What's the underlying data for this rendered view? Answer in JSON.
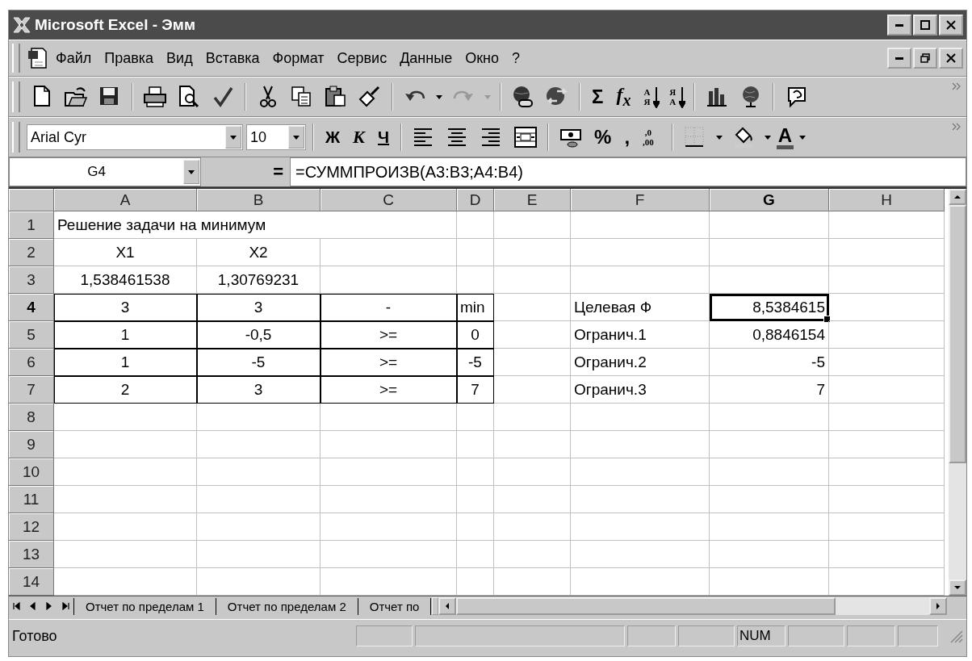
{
  "window": {
    "title": "Microsoft Excel - Эмм"
  },
  "menu": [
    {
      "label": "Файл"
    },
    {
      "label": "Правка"
    },
    {
      "label": "Вид"
    },
    {
      "label": "Вставка"
    },
    {
      "label": "Формат"
    },
    {
      "label": "Сервис"
    },
    {
      "label": "Данные"
    },
    {
      "label": "Окно"
    },
    {
      "label": "?"
    }
  ],
  "standard_toolbar": [
    {
      "kind": "new"
    },
    {
      "kind": "open"
    },
    {
      "kind": "save"
    },
    {
      "kind": "sep"
    },
    {
      "kind": "print"
    },
    {
      "kind": "preview"
    },
    {
      "kind": "spell"
    },
    {
      "kind": "sep"
    },
    {
      "kind": "cut"
    },
    {
      "kind": "copy"
    },
    {
      "kind": "paste"
    },
    {
      "kind": "brush"
    },
    {
      "kind": "sep"
    },
    {
      "kind": "undo"
    },
    {
      "kind": "drop"
    },
    {
      "kind": "redo"
    },
    {
      "kind": "drop_gray"
    },
    {
      "kind": "sep"
    },
    {
      "kind": "link"
    },
    {
      "kind": "web"
    },
    {
      "kind": "sep"
    },
    {
      "kind": "text",
      "label": "Σ"
    },
    {
      "kind": "fx",
      "label": "f$_{x}$"
    },
    {
      "kind": "sort",
      "top": "А",
      "bottom": "Я"
    },
    {
      "kind": "sort",
      "top": "Я",
      "bottom": "А"
    },
    {
      "kind": "sep"
    },
    {
      "kind": "chart"
    },
    {
      "kind": "map"
    },
    {
      "kind": "sep"
    },
    {
      "kind": "help"
    }
  ],
  "formatting_toolbar": {
    "font": "Arial Cyr",
    "size": "10",
    "items": [
      {
        "kind": "sep"
      },
      {
        "kind": "bold",
        "label": "Ж"
      },
      {
        "kind": "italic",
        "label": "К"
      },
      {
        "kind": "underline",
        "label": "Ч"
      },
      {
        "kind": "sep"
      },
      {
        "kind": "align_left"
      },
      {
        "kind": "align_center"
      },
      {
        "kind": "align_right"
      },
      {
        "kind": "merge"
      },
      {
        "kind": "sep"
      },
      {
        "kind": "currency"
      },
      {
        "kind": "text",
        "label": "%"
      },
      {
        "kind": "text",
        "label": ","
      },
      {
        "kind": "decimal",
        "top": ",0",
        "bottom": ",00"
      },
      {
        "kind": "sep"
      },
      {
        "kind": "borders"
      },
      {
        "kind": "drop"
      },
      {
        "kind": "fill"
      },
      {
        "kind": "drop"
      },
      {
        "kind": "fontcolor",
        "label": "A"
      },
      {
        "kind": "drop"
      }
    ]
  },
  "formula_bar": {
    "name_box": "G4",
    "equals": "=",
    "formula": "=СУММПРОИЗВ(A3:B3;A4:B4)"
  },
  "table": {
    "columns": [
      {
        "label": "A",
        "selected": false
      },
      {
        "label": "B",
        "selected": false
      },
      {
        "label": "C",
        "selected": false
      },
      {
        "label": "D",
        "selected": false
      },
      {
        "label": "E",
        "selected": false
      },
      {
        "label": "F",
        "selected": false
      },
      {
        "label": "G",
        "selected": true
      },
      {
        "label": "H",
        "selected": false
      }
    ],
    "rows": [
      {
        "header": "1",
        "selected": false,
        "cells": [
          "Решение задачи на минимум",
          null,
          null,
          null,
          null,
          null,
          null,
          null
        ]
      },
      {
        "header": "2",
        "selected": false,
        "cells": [
          "X1",
          "X2",
          null,
          null,
          null,
          null,
          null,
          null
        ]
      },
      {
        "header": "3",
        "selected": false,
        "cells": [
          "1,538461538",
          "1,30769231",
          null,
          null,
          null,
          null,
          null,
          null
        ]
      },
      {
        "header": "4",
        "selected": true,
        "cells": [
          "3",
          "3",
          "-",
          "min",
          null,
          "Целевая Ф",
          "8,5384615",
          null
        ]
      },
      {
        "header": "5",
        "selected": false,
        "cells": [
          "1",
          "-0,5",
          ">=",
          "0",
          null,
          "Огранич.1",
          "0,8846154",
          null
        ]
      },
      {
        "header": "6",
        "selected": false,
        "cells": [
          "1",
          "-5",
          ">=",
          "-5",
          null,
          "Огранич.2",
          "-5",
          null
        ]
      },
      {
        "header": "7",
        "selected": false,
        "cells": [
          "2",
          "3",
          ">=",
          "7",
          null,
          "Огранич.3",
          "7",
          null
        ]
      },
      {
        "header": "8",
        "selected": false,
        "cells": [
          null,
          null,
          null,
          null,
          null,
          null,
          null,
          null
        ]
      },
      {
        "header": "9",
        "selected": false,
        "cells": [
          null,
          null,
          null,
          null,
          null,
          null,
          null,
          null
        ]
      },
      {
        "header": "10",
        "selected": false,
        "cells": [
          null,
          null,
          null,
          null,
          null,
          null,
          null,
          null
        ]
      },
      {
        "header": "11",
        "selected": false,
        "cells": [
          null,
          null,
          null,
          null,
          null,
          null,
          null,
          null
        ]
      },
      {
        "header": "12",
        "selected": false,
        "cells": [
          null,
          null,
          null,
          null,
          null,
          null,
          null,
          null
        ]
      },
      {
        "header": "13",
        "selected": false,
        "cells": [
          null,
          null,
          null,
          null,
          null,
          null,
          null,
          null
        ]
      },
      {
        "header": "14",
        "selected": false,
        "cells": [
          null,
          null,
          null,
          null,
          null,
          null,
          null,
          null
        ]
      }
    ]
  },
  "sheet_tabs": [
    {
      "label": "Отчет по пределам 1",
      "selected": false
    },
    {
      "label": "Отчет по пределам 2",
      "selected": false
    },
    {
      "label": "Отчет по",
      "selected": false
    }
  ],
  "status_bar": {
    "text": "Готово",
    "num_indicator": "NUM"
  }
}
